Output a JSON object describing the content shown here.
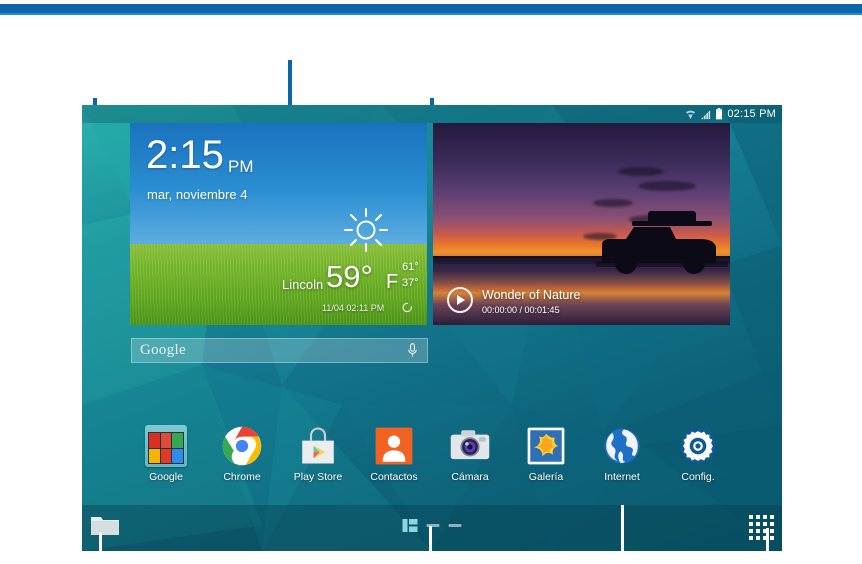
{
  "device": {
    "name": "android-tablet-home-screen",
    "orientation": "landscape"
  },
  "statusbar": {
    "wifi_icon": "wifi-icon",
    "signal_icon": "signal-bars-icon",
    "battery_icon": "battery-icon",
    "clock": "02:15 PM"
  },
  "weather_widget": {
    "name": "clock-weather-widget",
    "time": "2:15",
    "ampm": "PM",
    "date": "mar, noviembre 4",
    "condition_icon": "sun-icon",
    "city": "Lincoln",
    "temperature": "59°",
    "unit": "F",
    "high": "61°",
    "low": "37°",
    "updated": "11/04 02:11 PM",
    "refresh_icon": "refresh-icon"
  },
  "video_widget": {
    "name": "video-player-widget",
    "play_icon": "play-icon",
    "title": "Wonder of Nature",
    "elapsed": "00:00:00",
    "duration": "00:01:45",
    "time_display": "00:00:00 / 00:01:45"
  },
  "search": {
    "name": "google-search-bar",
    "logo_text": "Google",
    "placeholder": "Google",
    "mic_icon": "microphone-icon"
  },
  "apps": [
    {
      "label": "Google",
      "icon": "google-folder-icon"
    },
    {
      "label": "Chrome",
      "icon": "chrome-icon"
    },
    {
      "label": "Play Store",
      "icon": "play-store-icon"
    },
    {
      "label": "Contactos",
      "icon": "contacts-icon"
    },
    {
      "label": "Cámara",
      "icon": "camera-icon"
    },
    {
      "label": "Galería",
      "icon": "gallery-icon"
    },
    {
      "label": "Internet",
      "icon": "internet-globe-icon"
    },
    {
      "label": "Config.",
      "icon": "settings-gear-icon"
    }
  ],
  "navbar": {
    "recents_icon": "recent-apps-icon",
    "page_indicator_icon": "home-page-indicator-icon",
    "page_dashes": 2,
    "apps_grid_icon": "apps-grid-icon"
  },
  "colors": {
    "accent_blue": "#0b66ab",
    "rule_highlight": "#1d8ed0",
    "wallpaper_teal": "#12758c",
    "callout_white": "#ffffff"
  },
  "callouts": {
    "top_left_line": "leader-line-status-area",
    "top_center_line": "leader-line-widget",
    "top_right_line": "leader-line-statusbar",
    "double_arrow": "panning-double-arrow",
    "bottom_left_line": "leader-line-recents",
    "bottom_center_line": "leader-line-page-indicator",
    "bottom_right_line": "leader-line-internet",
    "bottom_far_right_line": "leader-line-apps-grid"
  }
}
